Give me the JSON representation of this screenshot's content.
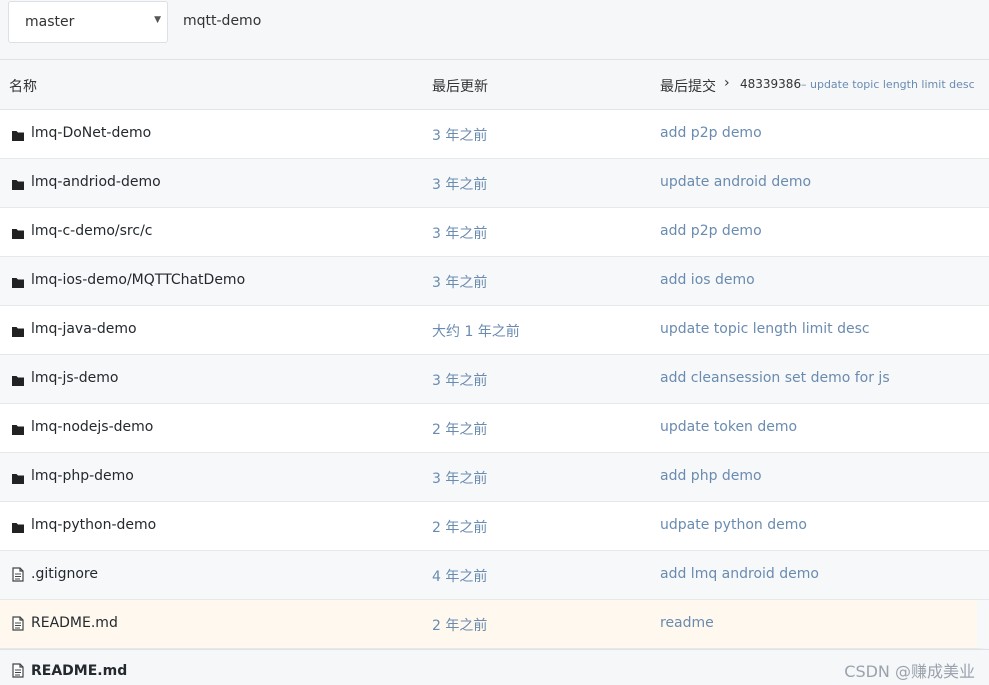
{
  "branch": {
    "label": "master"
  },
  "repo": {
    "name": "mqtt-demo"
  },
  "table": {
    "headers": {
      "name": "名称",
      "updated": "最后更新",
      "commit": "最后提交"
    },
    "last_commit": {
      "sha": "48339386",
      "message": "– update topic length limit desc"
    },
    "rows": [
      {
        "type": "folder",
        "name": "lmq-DoNet-demo",
        "time": "3 年之前",
        "message": "add p2p demo"
      },
      {
        "type": "folder",
        "name": "lmq-andriod-demo",
        "time": "3 年之前",
        "message": "update android demo"
      },
      {
        "type": "folder",
        "name": "lmq-c-demo/src/c",
        "time": "3 年之前",
        "message": "add p2p demo"
      },
      {
        "type": "folder",
        "name": "lmq-ios-demo/MQTTChatDemo",
        "time": "3 年之前",
        "message": "add ios demo"
      },
      {
        "type": "folder",
        "name": "lmq-java-demo",
        "time": "大约 1 年之前",
        "message": "update topic length limit desc"
      },
      {
        "type": "folder",
        "name": "lmq-js-demo",
        "time": "3 年之前",
        "message": "add cleansession set demo for js"
      },
      {
        "type": "folder",
        "name": "lmq-nodejs-demo",
        "time": "2 年之前",
        "message": "update token demo"
      },
      {
        "type": "folder",
        "name": "lmq-php-demo",
        "time": "3 年之前",
        "message": "add php demo"
      },
      {
        "type": "folder",
        "name": "lmq-python-demo",
        "time": "2 年之前",
        "message": "udpate python demo"
      },
      {
        "type": "file",
        "name": ".gitignore",
        "time": "4 年之前",
        "message": "add lmq android demo"
      },
      {
        "type": "file",
        "name": "README.md",
        "time": "2 年之前",
        "message": "readme"
      }
    ]
  },
  "readme": {
    "title": "README.md"
  },
  "watermark": "CSDN @赚成美业",
  "colors": {
    "link": "#6a8bb0",
    "header_bg": "#f5f7f9",
    "highlight_row": "#fff8ee"
  }
}
